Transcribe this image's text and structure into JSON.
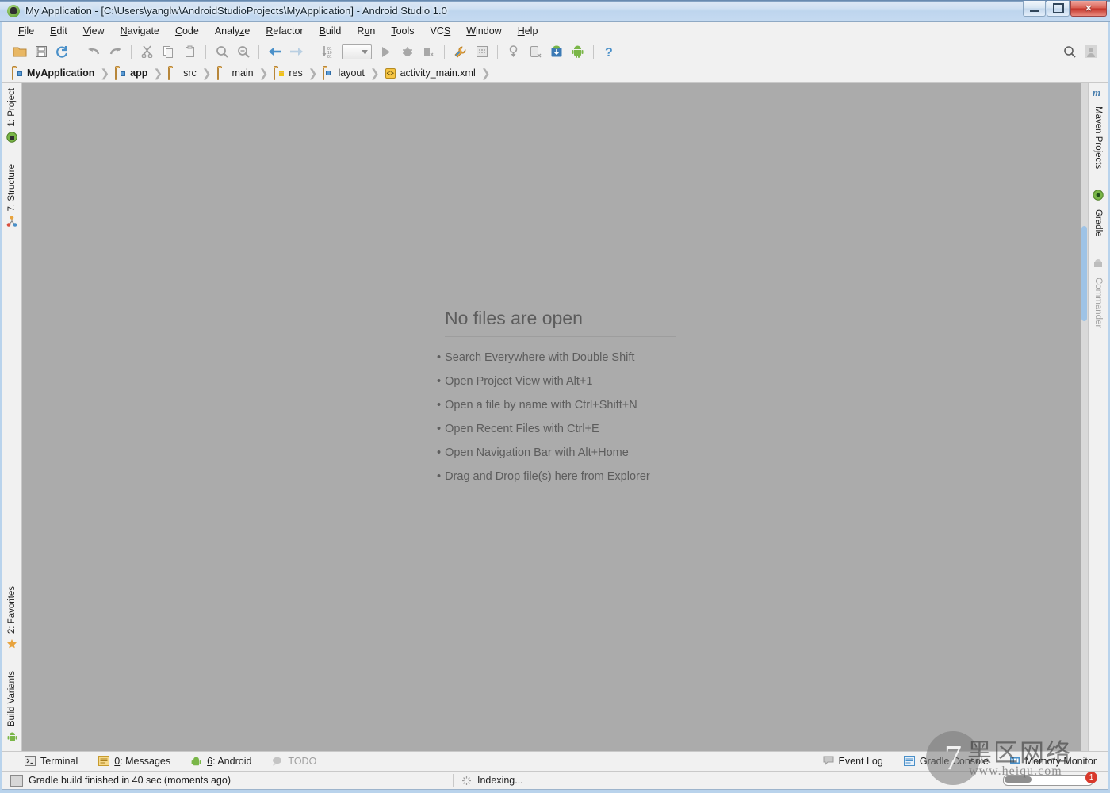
{
  "window": {
    "title": "My Application - [C:\\Users\\yanglw\\AndroidStudioProjects\\MyApplication] - Android Studio 1.0",
    "app_icon": "android-studio-icon",
    "controls": {
      "minimize": "minimize-button",
      "restore": "restore-button",
      "close": "close-button",
      "close_glyph": "✕"
    }
  },
  "menubar": [
    {
      "label": "File",
      "mnemonic": "F"
    },
    {
      "label": "Edit",
      "mnemonic": "E"
    },
    {
      "label": "View",
      "mnemonic": "V"
    },
    {
      "label": "Navigate",
      "mnemonic": "N"
    },
    {
      "label": "Code",
      "mnemonic": "C"
    },
    {
      "label": "Analyze",
      "mnemonic": "z"
    },
    {
      "label": "Refactor",
      "mnemonic": "R"
    },
    {
      "label": "Build",
      "mnemonic": "B"
    },
    {
      "label": "Run",
      "mnemonic": "u"
    },
    {
      "label": "Tools",
      "mnemonic": "T"
    },
    {
      "label": "VCS",
      "mnemonic": "S"
    },
    {
      "label": "Window",
      "mnemonic": "W"
    },
    {
      "label": "Help",
      "mnemonic": "H"
    }
  ],
  "toolbar": {
    "items": [
      "open-folder-icon",
      "save-all-icon",
      "sync-refresh-icon",
      "undo-icon",
      "redo-icon",
      "cut-icon",
      "copy-icon",
      "paste-icon",
      "find-icon",
      "replace-icon",
      "back-icon",
      "forward-icon",
      "sort-numeric-icon",
      "run-config-combo",
      "run-icon",
      "debug-icon",
      "stop-icon",
      "sdk-manager-icon",
      "avd-manager-icon",
      "sync-gradle-icon",
      "device-monitor-icon",
      "android-download-icon",
      "android-icon",
      "help-icon"
    ],
    "right_items": [
      "search-icon",
      "user-avatar-icon"
    ]
  },
  "breadcrumb": [
    {
      "label": "MyApplication",
      "icon": "module-folder-icon",
      "bold": true
    },
    {
      "label": "app",
      "icon": "module-folder-icon",
      "bold": true
    },
    {
      "label": "src",
      "icon": "folder-icon",
      "bold": false
    },
    {
      "label": "main",
      "icon": "folder-icon",
      "bold": false
    },
    {
      "label": "res",
      "icon": "res-folder-icon",
      "bold": false
    },
    {
      "label": "layout",
      "icon": "layout-folder-icon",
      "bold": false
    },
    {
      "label": "activity_main.xml",
      "icon": "xml-file-icon",
      "bold": false
    }
  ],
  "left_stripe": {
    "top": [
      {
        "label": "1: Project",
        "mnemonic": "1",
        "icon": "project-icon"
      },
      {
        "label": "7: Structure",
        "mnemonic": "7",
        "icon": "structure-icon"
      }
    ],
    "bottom": [
      {
        "label": "2: Favorites",
        "mnemonic": "2",
        "icon": "star-icon"
      },
      {
        "label": "Build Variants",
        "mnemonic": "",
        "icon": "android-icon"
      }
    ]
  },
  "right_stripe": [
    {
      "label": "Maven Projects",
      "icon": "maven-icon",
      "disabled": false
    },
    {
      "label": "Gradle",
      "icon": "gradle-icon",
      "disabled": false
    },
    {
      "label": "Commander",
      "icon": "commander-icon",
      "disabled": true
    }
  ],
  "editor": {
    "empty_title": "No files are open",
    "tips": [
      "Search Everywhere with Double Shift",
      "Open Project View with Alt+1",
      "Open a file by name with Ctrl+Shift+N",
      "Open Recent Files with Ctrl+E",
      "Open Navigation Bar with Alt+Home",
      "Drag and Drop file(s) here from Explorer"
    ],
    "bullet": "•",
    "background_color": "#ababab"
  },
  "bottom_stripe": {
    "left": [
      {
        "label": "Terminal",
        "mnemonic": "",
        "icon": "terminal-icon",
        "disabled": false
      },
      {
        "label": "0: Messages",
        "mnemonic": "0",
        "icon": "messages-icon",
        "disabled": false
      },
      {
        "label": "6: Android",
        "mnemonic": "6",
        "icon": "android-icon",
        "disabled": false
      },
      {
        "label": "TODO",
        "mnemonic": "",
        "icon": "todo-icon",
        "disabled": true
      }
    ],
    "right": [
      {
        "label": "Event Log",
        "icon": "event-log-icon"
      },
      {
        "label": "Gradle Console",
        "icon": "gradle-console-icon"
      },
      {
        "label": "Memory Monitor",
        "icon": "memory-monitor-icon"
      }
    ]
  },
  "statusbar": {
    "message": "Gradle build finished in 40 sec (moments ago)",
    "message_icon": "widget-icon",
    "progress_label": "Indexing...",
    "progress_icon": "spinner-icon",
    "progress_percent": 30
  },
  "watermark": {
    "logo": "7",
    "chinese": "黑区网络",
    "url": "www.heiqu.com",
    "badge": "1"
  },
  "colors": {
    "titlebar": "#cfe0f2",
    "chrome": "#f1f1f1",
    "editor_bg": "#ababab",
    "text": "#1d1d1d",
    "tip_text": "#5d5d5d",
    "accent_close": "#c3342a",
    "android_green": "#7ab648"
  }
}
